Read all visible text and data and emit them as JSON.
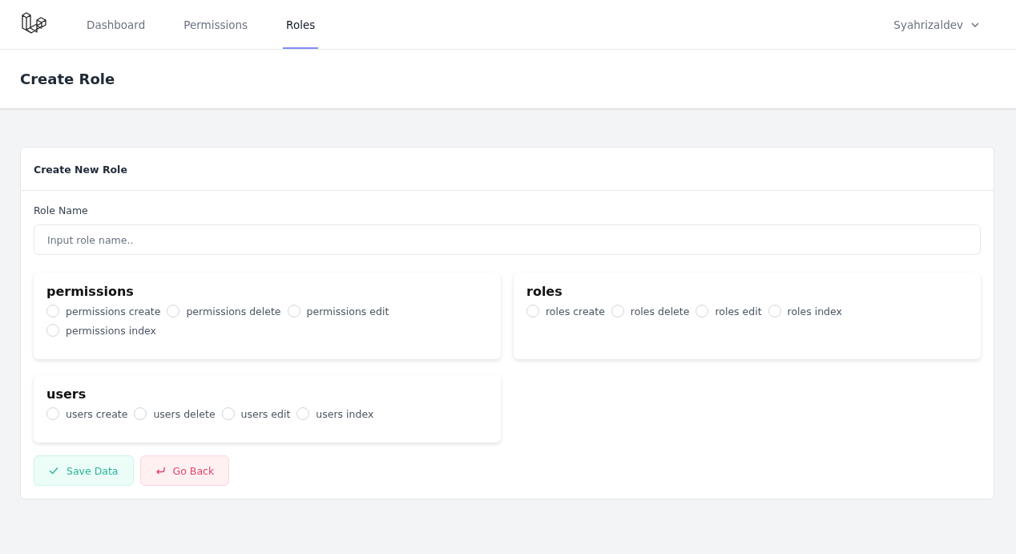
{
  "nav": {
    "links": [
      {
        "label": "Dashboard",
        "selected": false
      },
      {
        "label": "Permissions",
        "selected": false
      },
      {
        "label": "Roles",
        "selected": true
      }
    ],
    "user": "Syahrizaldev"
  },
  "page_title": "Create Role",
  "card": {
    "title": "Create New Role",
    "field_label": "Role Name",
    "placeholder": "Input role name..",
    "groups": [
      {
        "name": "permissions",
        "items": [
          {
            "label": "permissions create",
            "checked": false
          },
          {
            "label": "permissions delete",
            "checked": false
          },
          {
            "label": "permissions edit",
            "checked": false
          },
          {
            "label": "permissions index",
            "checked": false
          }
        ]
      },
      {
        "name": "roles",
        "items": [
          {
            "label": "roles create",
            "checked": false
          },
          {
            "label": "roles delete",
            "checked": false
          },
          {
            "label": "roles edit",
            "checked": false
          },
          {
            "label": "roles index",
            "checked": false
          }
        ]
      },
      {
        "name": "users",
        "items": [
          {
            "label": "users create",
            "checked": false
          },
          {
            "label": "users delete",
            "checked": false
          },
          {
            "label": "users edit",
            "checked": false
          },
          {
            "label": "users index",
            "checked": false
          }
        ]
      }
    ],
    "buttons": [
      {
        "kind": "save",
        "label": "Save Data"
      },
      {
        "kind": "back",
        "label": "Go Back"
      }
    ]
  }
}
